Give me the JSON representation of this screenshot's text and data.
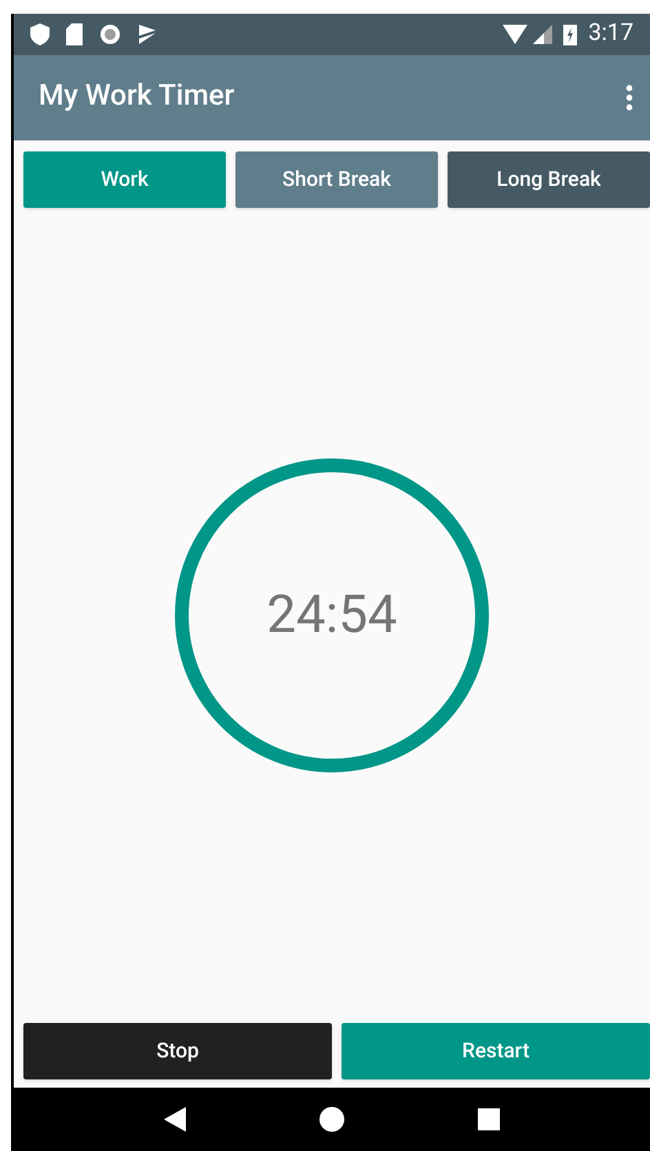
{
  "status_bar": {
    "time": "3:17"
  },
  "app_bar": {
    "title": "My Work Timer"
  },
  "tabs": [
    {
      "label": "Work",
      "selected": true
    },
    {
      "label": "Short Break",
      "selected": false,
      "color": "#607d8b"
    },
    {
      "label": "Long Break",
      "selected": false,
      "color": "#455a64"
    }
  ],
  "timer": {
    "time": "24:54",
    "level": 1
  },
  "buttons": [
    {
      "label": "Stop",
      "kind": "dark"
    },
    {
      "label": "Restart",
      "kind": "accent"
    }
  ]
}
